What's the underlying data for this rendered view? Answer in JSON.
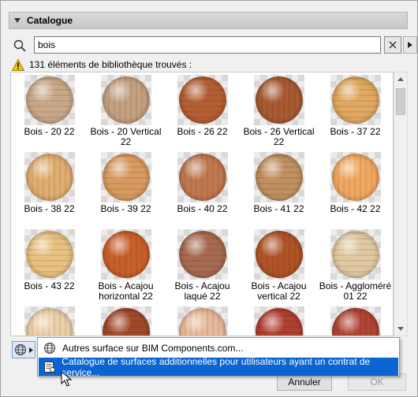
{
  "section": {
    "title": "Catalogue"
  },
  "search": {
    "value": "bois",
    "placeholder": ""
  },
  "results": {
    "message": "131 éléments de bibliothèque trouvés :"
  },
  "items": [
    {
      "label": "Bois - 20 22",
      "color": "#c9a888"
    },
    {
      "label": "Bois - 20 Vertical 22",
      "color": "#c4a080"
    },
    {
      "label": "Bois - 26 22",
      "color": "#b45f33"
    },
    {
      "label": "Bois - 26 Vertical 22",
      "color": "#a85a33"
    },
    {
      "label": "Bois - 37 22",
      "color": "#e0a860"
    },
    {
      "label": "Bois - 38 22",
      "color": "#e0ad70"
    },
    {
      "label": "Bois - 39 22",
      "color": "#d99a60"
    },
    {
      "label": "Bois - 40 22",
      "color": "#c07850"
    },
    {
      "label": "Bois - 41 22",
      "color": "#c09060"
    },
    {
      "label": "Bois - 42 22",
      "color": "#f0a860"
    },
    {
      "label": "Bois - 43 22",
      "color": "#e8c080"
    },
    {
      "label": "Bois - Acajou horizontal 22",
      "color": "#c8602a"
    },
    {
      "label": "Bois - Acajou laqué 22",
      "color": "#a86a50"
    },
    {
      "label": "Bois - Acajou vertical 22",
      "color": "#b05428"
    },
    {
      "label": "Bois - Aggloméré 01 22",
      "color": "#e0c8a0"
    },
    {
      "label": "",
      "color": "#ebcfa8"
    },
    {
      "label": "",
      "color": "#a04a2a"
    },
    {
      "label": "",
      "color": "#e8b898"
    },
    {
      "label": "",
      "color": "#b04030"
    },
    {
      "label": "",
      "color": "#b04535"
    }
  ],
  "menu": {
    "item1": "Autres surface sur BIM Components.com...",
    "item2": "Catalogue de surfaces additionnelles pour utilisateurs ayant un contrat de service..."
  },
  "buttons": {
    "cancel": "Annuler",
    "ok": "OK"
  },
  "icons": {
    "search": "search-icon",
    "clear": "close-icon",
    "arrow": "chevron-right-icon",
    "warning": "warning-icon",
    "globe": "globe-icon",
    "catalogue": "catalogue-icon"
  },
  "colors": {
    "highlight": "#0a64d2",
    "warning": "#f5c400"
  }
}
